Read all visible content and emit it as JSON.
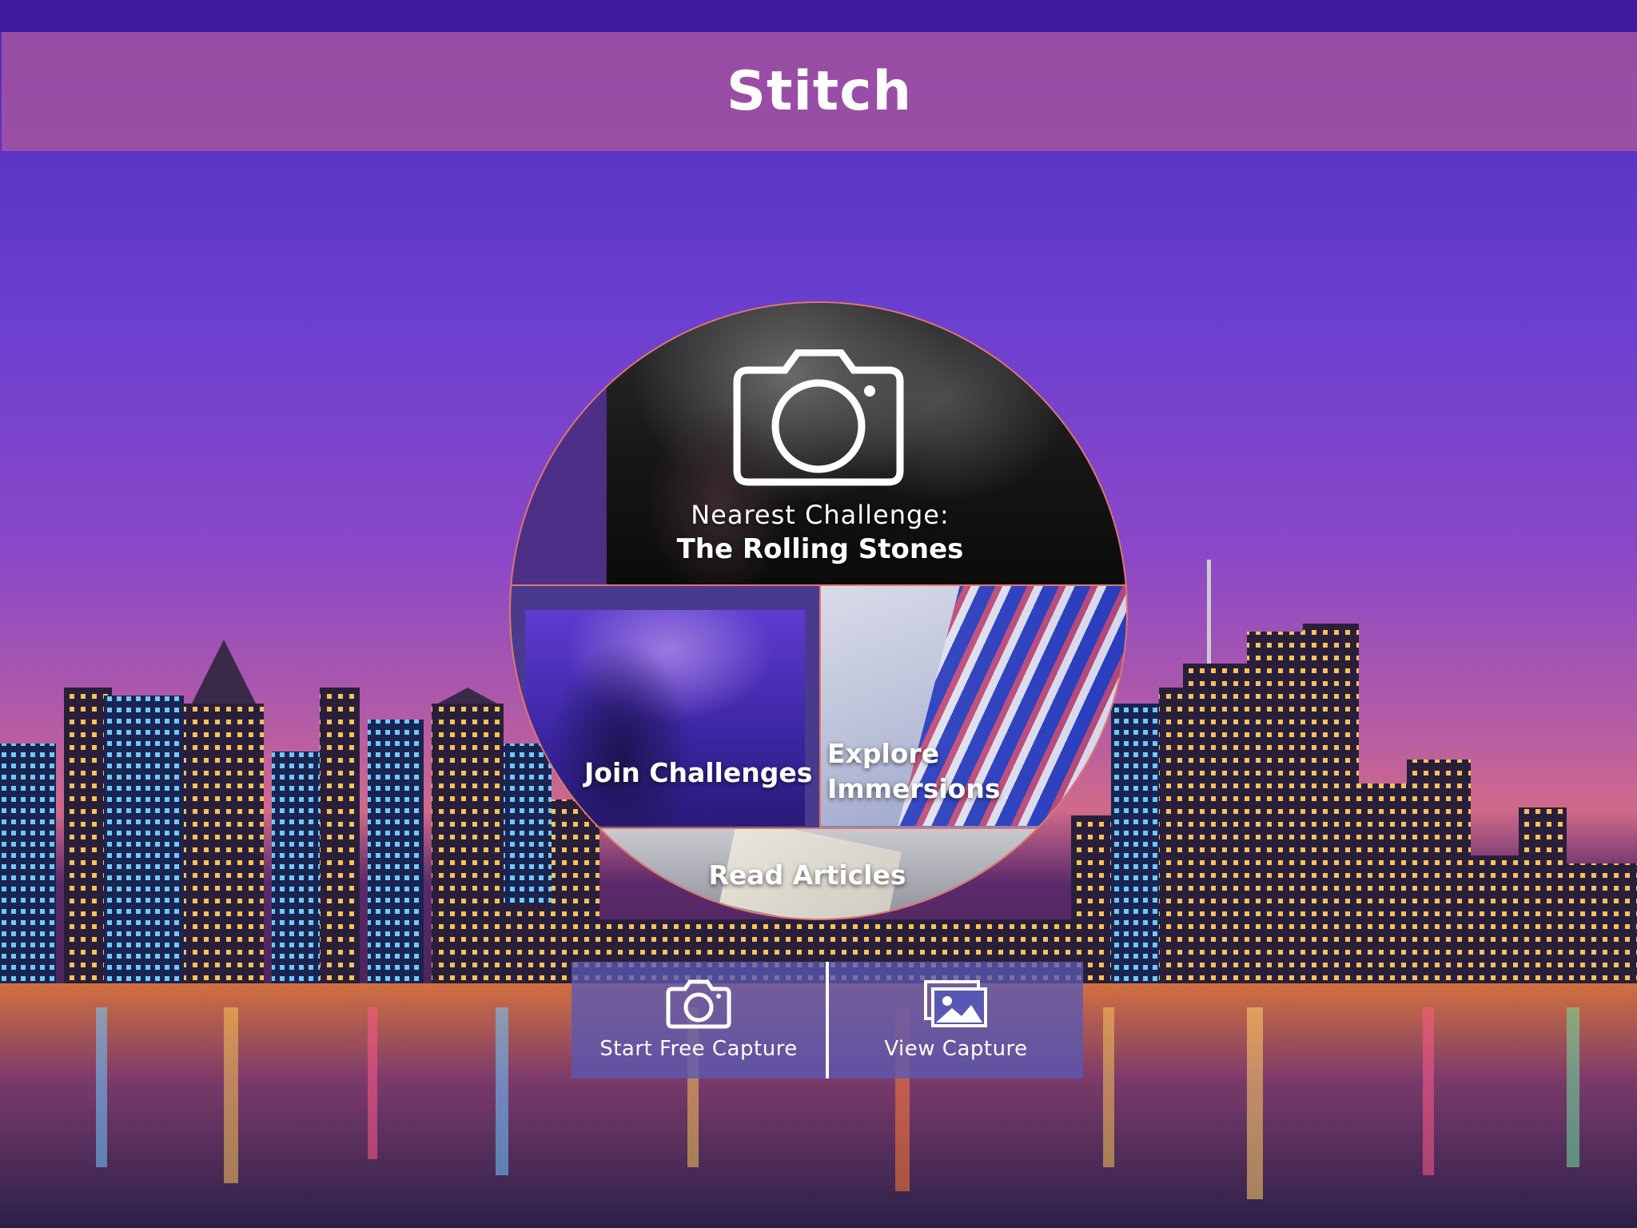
{
  "app": {
    "title": "Stitch"
  },
  "circle_menu": {
    "nearest_challenge": {
      "label": "Nearest Challenge:",
      "name": "The Rolling Stones",
      "icon": "camera-icon"
    },
    "join_challenges": {
      "label": "Join Challenges"
    },
    "explore_immersions": {
      "line1": "Explore",
      "line2": "Immersions"
    },
    "read_articles": {
      "label": "Read Articles"
    }
  },
  "actions": {
    "start_free_capture": {
      "label": "Start Free Capture",
      "icon": "camera-icon"
    },
    "view_capture": {
      "label": "View Capture",
      "icon": "gallery-icon"
    }
  },
  "colors": {
    "status_bar": "#3f1aa0",
    "title_bar": "#a854a0",
    "circle_border": "#e07868",
    "action_panel": "#5858b4"
  }
}
